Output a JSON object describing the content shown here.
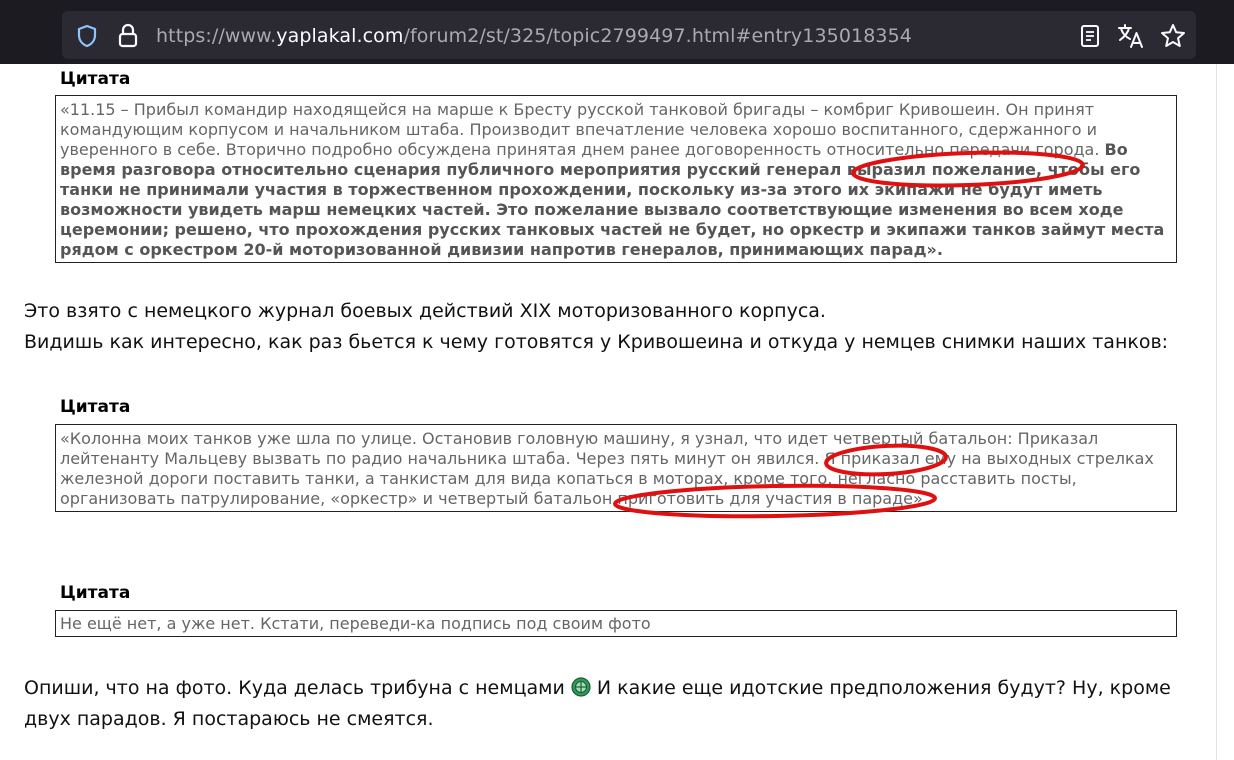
{
  "browser": {
    "url_prefix": "https://www.",
    "url_host": "yaplakal.com",
    "url_path": "/forum2/st/325/topic2799497.html#entry135018354"
  },
  "quote1": {
    "title": "Цитата",
    "normal": "«11.15 – Прибыл командир находящейся на марше к Бресту русской танковой бригады – комбриг Кривошеин. Он принят командующим корпусом и начальником штаба. Производит впечатление человека хорошо воспитанного, сдержанного и уверенного в себе. Вторично подробно обсуждена принятая днем ранее договоренность относительно передачи города.",
    "bold": "Во время разговора относительно сценария публичного мероприятия русский генерал выразил пожелание, чтобы его танки не принимали участия в торжественном прохождении, поскольку из-за этого их экипажи не будут иметь возможности увидеть марш немецких частей. Это пожелание вызвало соответствующие изменения во всем ходе церемонии; решено, что прохождения русских танковых частей не будет, но оркестр и экипажи танков займут места рядом с оркестром 20-й моторизованной дивизии напротив генералов, принимающих парад»."
  },
  "text1": {
    "line1": "Это взято с немецкого журнал боевых действий XIX моторизованного корпуса.",
    "line2": "Видишь как интересно, как раз бьется к чему готовятся у Кривошеина и откуда у немцев снимки наших танков:"
  },
  "quote2": {
    "title": "Цитата",
    "text": "«Колонна моих танков уже шла по улице. Остановив головную машину, я узнал, что идет четвертый батальон: Приказал лейтенанту Мальцеву вызвать по радио начальника штаба. Через пять минут он явился. Я приказал ему на выходных стрелках железной дороги поставить танки, а танкистам для вида копаться в моторах, кроме того, негласно расставить посты, организовать патрулирование, «оркестр» и четвертый батальон приготовить для участия в параде»."
  },
  "quote3": {
    "title": "Цитата",
    "text": "Не ещё нет, а уже нет. Кстати, переведи-ка подпись под своим фото"
  },
  "text2": {
    "part1": "Опиши, что на фото. Куда делась трибуна с немцами",
    "part2": "И какие еще идотские предположения будут? Ну, кроме двух парадов. Я постараюсь не смеятся."
  },
  "colors": {
    "annotation": "#e01010",
    "chrome": "#1c1b22",
    "urlbar": "#2b2a33"
  },
  "icons": [
    "shield-icon",
    "lock-icon",
    "reader-view-icon",
    "translate-icon",
    "star-bookmark-icon",
    "smiley-icon"
  ]
}
